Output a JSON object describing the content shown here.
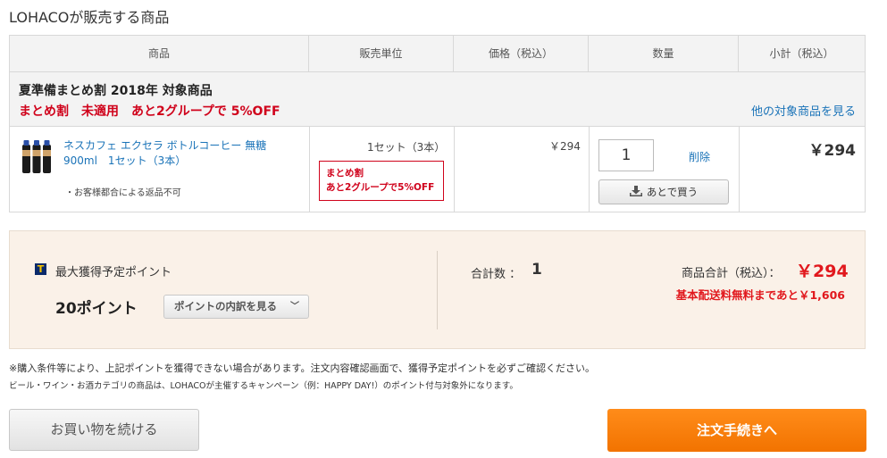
{
  "section_title": "LOHACOが販売する商品",
  "table": {
    "headers": [
      "商品",
      "販売単位",
      "価格（税込）",
      "数量",
      "小計（税込）"
    ],
    "group": {
      "title": "夏準備まとめ割 2018年 対象商品",
      "status": "まとめ割　未適用　あと2グループで 5%OFF",
      "link": "他の対象商品を見る"
    },
    "item": {
      "name": "ネスカフェ エクセラ ボトルコーヒー 無糖 900ml　1セット（3本）",
      "note": "・お客様都合による返品不可",
      "unit": "1セット（3本）",
      "promo_line1": "まとめ割",
      "promo_line2": "あと2グループで5%OFF",
      "price": "￥294",
      "quantity": "1",
      "delete": "削除",
      "later": "あとで買う",
      "subtotal": "￥294"
    }
  },
  "summary": {
    "points_label": "最大獲得予定ポイント",
    "points_icon": "T",
    "points_value": "20ポイント",
    "points_button": "ポイントの内訳を見る",
    "count_label": "合計数 ：",
    "count_value": "1",
    "total_label": "商品合計（税込）：",
    "total_value": "￥294",
    "shipping_note": "基本配送料無料まであと￥1,606"
  },
  "notes": {
    "line1": "※購入条件等により、上記ポイントを獲得できない場合があります。注文内容確認画面で、獲得予定ポイントを必ずご確認ください。",
    "line2": "ビール・ワイン・お酒カテゴリの商品は、LOHACOが主催するキャンペーン（例：HAPPY DAY!）のポイント付与対象外になります。"
  },
  "buttons": {
    "continue": "お買い物を続ける",
    "checkout": "注文手続きへ"
  },
  "colors": {
    "accent_red": "#e1181d",
    "link_blue": "#1a73b8",
    "checkout_orange": "#f27300",
    "summary_bg": "#faf1e8"
  }
}
